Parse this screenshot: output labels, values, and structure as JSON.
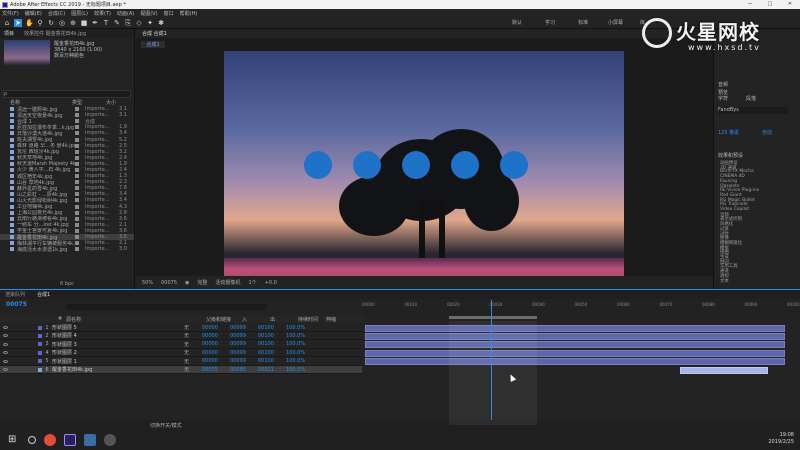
{
  "window": {
    "title": "Adobe After Effects CC 2019 - 无标题项目.aep *",
    "controls": [
      "—",
      "□",
      "✕"
    ]
  },
  "menu": [
    "文件(F)",
    "编辑(E)",
    "合成(C)",
    "图层(L)",
    "效果(T)",
    "动画(A)",
    "视图(V)",
    "窗口",
    "帮助(H)"
  ],
  "workspaces": [
    "默认",
    "学习",
    "标准",
    "小屏幕",
    "库"
  ],
  "project": {
    "tabs": [
      "项目",
      "效果控件 醒金香花田4k.jpg"
    ],
    "file_name": "醒金香花田4k.jpg",
    "file_details": "3840 x 2160 (1.00)",
    "file_extra": "数百万种颜色",
    "search_placeholder": "ρ",
    "columns": {
      "name": "名称",
      "type": "类型",
      "size": "大小"
    },
    "files": [
      {
        "name": "清远一键照4k.jpg",
        "type": "Importe...",
        "size": "3.1"
      },
      {
        "name": "清远天空夜景4k.jpg",
        "type": "Importe...",
        "size": "3.1"
      },
      {
        "name": "合成 1",
        "type": "合成",
        "size": ""
      },
      {
        "name": "尼亚加拉瀑布冬季...k.jpg",
        "type": "Importe...",
        "size": "1.9"
      },
      {
        "name": "日落沙漠大道4k.jpg",
        "type": "Importe...",
        "size": "3.4"
      },
      {
        "name": "班夫湖雪4k.jpg",
        "type": "Importe...",
        "size": "5.2"
      },
      {
        "name": "森林 道路 早...冬 景4k.jpg",
        "type": "Importe...",
        "size": "2.5"
      },
      {
        "name": "瓦伦 西班牙4k.jpg",
        "type": "Importe...",
        "size": "3.2"
      },
      {
        "name": "秋天草地4k.jpg",
        "type": "Importe...",
        "size": "2.4"
      },
      {
        "name": "秋天道Marsh Majesty 4k.jpg",
        "type": "Importe...",
        "size": "1.9"
      },
      {
        "name": "火少 黄人平...石 4k.jpg",
        "type": "Importe...",
        "size": "2.4"
      },
      {
        "name": "城区宿年4k.jpg",
        "type": "Importe...",
        "size": "1.3"
      },
      {
        "name": "山谷 草地4k.jpg",
        "type": "Importe...",
        "size": "2.3"
      },
      {
        "name": "赫外星的雪4k.jpg",
        "type": "Importe...",
        "size": "7.8"
      },
      {
        "name": "山之彩虹 - ...原4k.jpg",
        "type": "Importe...",
        "size": "3.4"
      },
      {
        "name": "山火光影绿松树4k.jpg",
        "type": "Importe...",
        "size": "3.4"
      },
      {
        "name": "工业地铺4k.jpg",
        "type": "Importe...",
        "size": "4.3"
      },
      {
        "name": "上海公园夜光4k.jpg",
        "type": "Importe...",
        "size": "2.8"
      },
      {
        "name": "云南行路滑坡看4k.jpg",
        "type": "Importe...",
        "size": "3.6"
      },
      {
        "name": "一刷车 分...iret 4k.jpg",
        "type": "Importe...",
        "size": "2.1"
      },
      {
        "name": "学金士宫景可夏4k.jpg",
        "type": "Importe...",
        "size": "3.6"
      },
      {
        "name": "醒金香花田4k.jpg",
        "type": "Importe...",
        "size": "3.5",
        "selected": true
      },
      {
        "name": "梅林湖平行车辆被服务4k.jpg",
        "type": "Importe...",
        "size": "2.1"
      },
      {
        "name": "海底活水水渗透1k.jpg",
        "type": "Importe...",
        "size": "3.0"
      }
    ],
    "footer": "8 bpc"
  },
  "comp": {
    "tabs": [
      "合成 合成1"
    ],
    "subtab": "合成1",
    "footer": {
      "zoom": "50%",
      "timecode": "00075",
      "res": "完整",
      "camera": "活动摄像机",
      "views": "1个",
      "offset": "+0.0"
    }
  },
  "right": {
    "info_title": "音频",
    "preview_title": "预览",
    "char_title": "字符",
    "para_title": "段落",
    "font": "FandBys",
    "size_label": "125 像素",
    "lead_label": "自动",
    "effects_title": "效果和预设",
    "effects": [
      "动画预设",
      "3D 通道",
      "Boris FX Mocha",
      "CINEMA 4D",
      "Fauxing",
      "Obsolete",
      "RE:Vision Plug-ins",
      "Red Giant",
      "RG Magic Bullet",
      "RG Trapcode",
      "Video Copilot",
      "音频",
      "表达式控制",
      "风格化",
      "过渡",
      "过时",
      "抠像",
      "模糊和锐化",
      "模拟",
      "扭曲",
      "生成",
      "时间",
      "实用工具",
      "通道",
      "透视",
      "文本"
    ]
  },
  "watermark": {
    "brand": "火星网校",
    "url": "www.hxsd.tv"
  },
  "timeline": {
    "tabs": [
      "渲染队列",
      "合成1"
    ],
    "timecode": "00075",
    "header": {
      "num": "#",
      "name": "源名称",
      "mode": "模式",
      "parent": "父级和链接",
      "in": "入",
      "out": "出",
      "duration": "持续时间",
      "stretch": "伸缩"
    },
    "layers": [
      {
        "num": "1",
        "name": "形状图层 5",
        "color": "#5b67c9",
        "mode": "无",
        "in": "00000",
        "out": "00099",
        "dur": "00100",
        "stretch": "100.0%"
      },
      {
        "num": "2",
        "name": "形状图层 4",
        "color": "#5b67c9",
        "mode": "无",
        "in": "00000",
        "out": "00099",
        "dur": "00100",
        "stretch": "100.0%"
      },
      {
        "num": "3",
        "name": "形状图层 3",
        "color": "#5b67c9",
        "mode": "无",
        "in": "00000",
        "out": "00099",
        "dur": "00100",
        "stretch": "100.0%"
      },
      {
        "num": "4",
        "name": "形状图层 2",
        "color": "#5b67c9",
        "mode": "无",
        "in": "00000",
        "out": "00099",
        "dur": "00100",
        "stretch": "100.0%"
      },
      {
        "num": "5",
        "name": "形状图层 1",
        "color": "#5b67c9",
        "mode": "无",
        "in": "00000",
        "out": "00099",
        "dur": "00100",
        "stretch": "100.0%"
      },
      {
        "num": "6",
        "name": "醒金香花田4k.jpg",
        "color": "#8aa4d6",
        "mode": "无",
        "in": "00075",
        "out": "00095",
        "dur": "00021",
        "stretch": "100.0%",
        "selected": true
      }
    ],
    "ruler": [
      "00000",
      "00010",
      "00020",
      "00030",
      "00040",
      "00050",
      "00060",
      "00070",
      "00080",
      "00090",
      "00100"
    ],
    "footer": "切换开关/模式"
  },
  "taskbar": {
    "time": "19:08",
    "date": "2019/2/25"
  }
}
